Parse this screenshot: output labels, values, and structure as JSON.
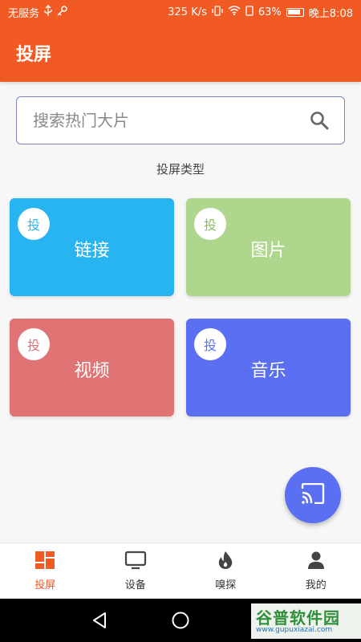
{
  "status_bar": {
    "carrier": "无服务",
    "speed": "325 K/s",
    "battery_pct": "63%",
    "time": "晚上8:08"
  },
  "app_bar": {
    "title": "投屏"
  },
  "search": {
    "placeholder": "搜索热门大片"
  },
  "section_title": "投屏类型",
  "cards": {
    "badge": "投",
    "link": {
      "label": "链接",
      "color": "#27b4f0"
    },
    "image": {
      "label": "图片",
      "color": "#aed68d"
    },
    "video": {
      "label": "视频",
      "color": "#e07373"
    },
    "music": {
      "label": "音乐",
      "color": "#5a6ff1"
    }
  },
  "fab": {
    "icon": "cast-icon"
  },
  "bottom_nav": {
    "cast": "投屏",
    "device": "设备",
    "sniff": "嗅探",
    "mine": "我的"
  },
  "watermark": {
    "main": "谷普软件园",
    "sub": "www.gupuxiazai.com"
  },
  "colors": {
    "accent": "#f15a22",
    "primary_blue": "#5a6ff1"
  }
}
